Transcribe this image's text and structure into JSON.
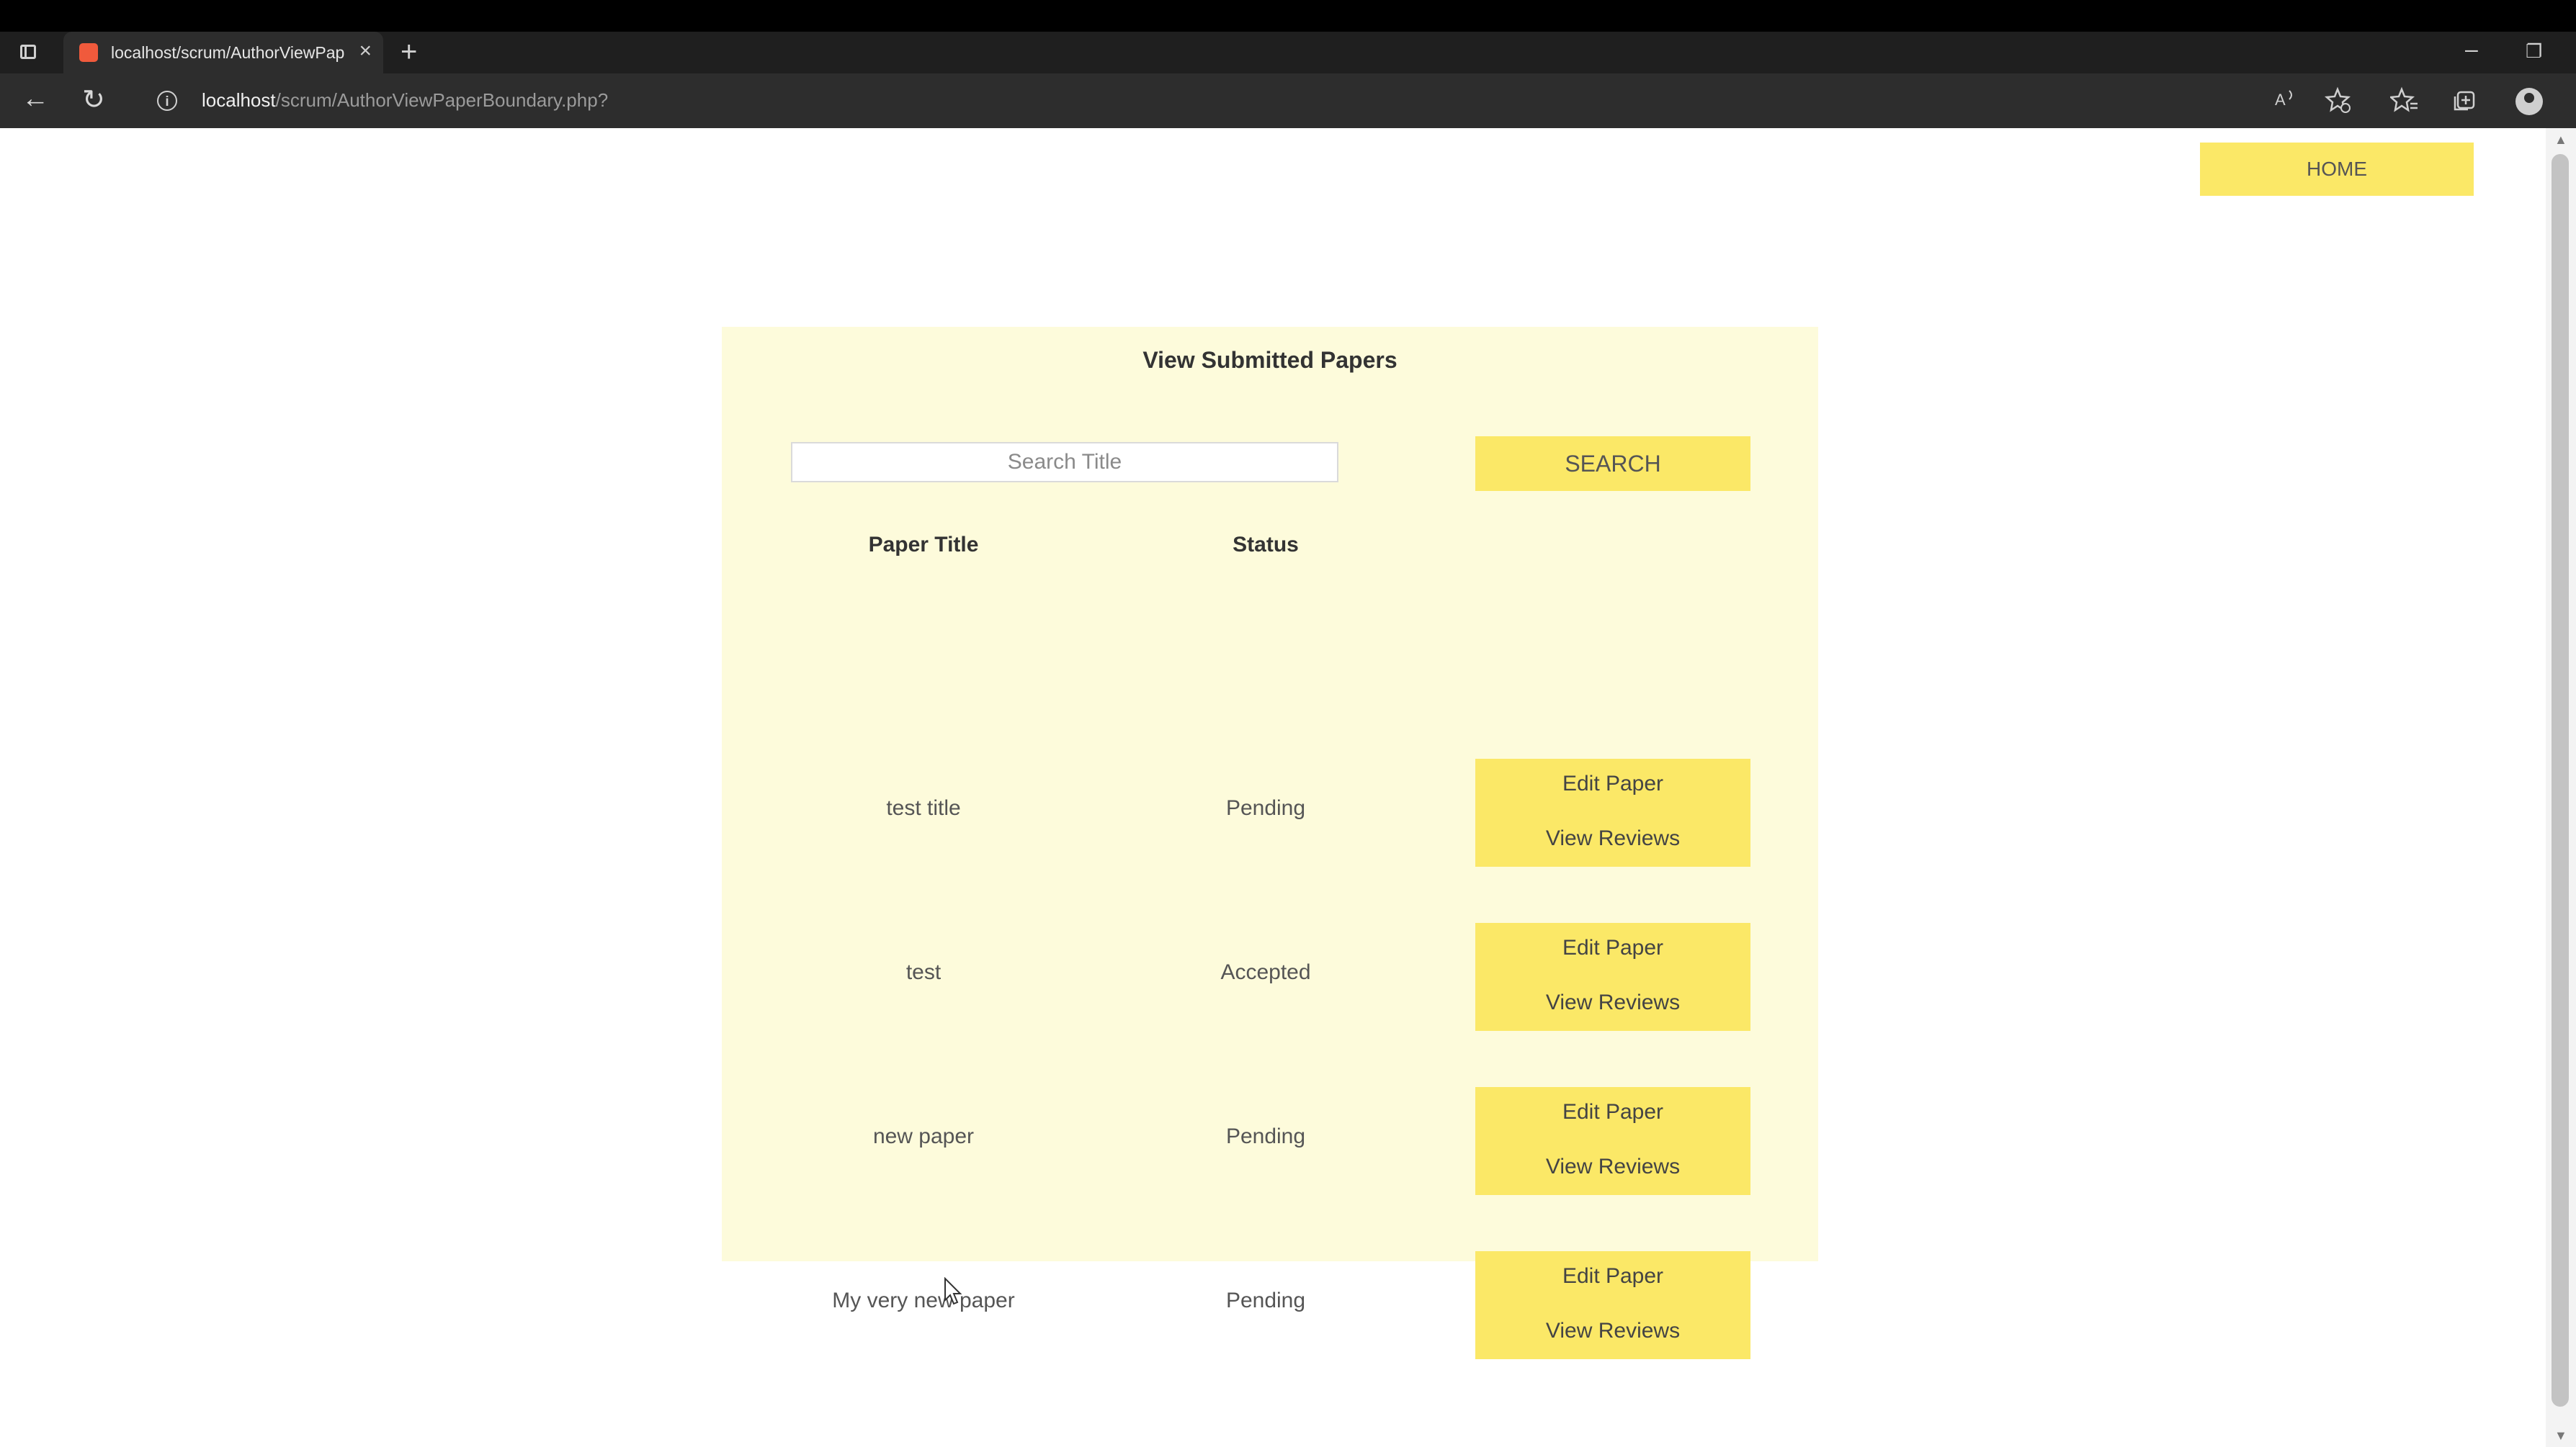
{
  "browser": {
    "tab_title": "localhost/scrum/AuthorViewPaperBoundary.php",
    "tab_close": "×",
    "new_tab": "+",
    "url_host": "localhost",
    "url_path": "/scrum/AuthorViewPaperBoundary.php?",
    "back_glyph": "←",
    "reload_glyph": "↻",
    "info_glyph": "i",
    "minimize_glyph": "–",
    "restore_glyph": "❐"
  },
  "page": {
    "home_label": "HOME",
    "panel_title": "View Submitted Papers",
    "search": {
      "placeholder": "Search Title",
      "value": "",
      "button_label": "SEARCH"
    },
    "table": {
      "headers": [
        "Paper Title",
        "Status"
      ],
      "rows": [
        {
          "title": "test title",
          "status": "Pending",
          "edit_label": "Edit Paper",
          "reviews_label": "View Reviews"
        },
        {
          "title": "test",
          "status": "Accepted",
          "edit_label": "Edit Paper",
          "reviews_label": "View Reviews"
        },
        {
          "title": "new paper",
          "status": "Pending",
          "edit_label": "Edit Paper",
          "reviews_label": "View Reviews"
        },
        {
          "title": "My very new paper",
          "status": "Pending",
          "edit_label": "Edit Paper",
          "reviews_label": "View Reviews"
        }
      ]
    }
  },
  "colors": {
    "accent_yellow": "#fbe867",
    "panel_bg": "#fdfbdb",
    "chrome_dark": "#2d2d2d"
  },
  "icons": [
    "tab-actions-icon",
    "favicon-icon",
    "close-icon",
    "plus-icon",
    "back-icon",
    "reload-icon",
    "info-icon",
    "read-aloud-icon",
    "add-favorite-icon",
    "favorites-icon",
    "collections-icon",
    "profile-icon",
    "minimize-icon",
    "restore-icon",
    "mouse-cursor-icon"
  ]
}
